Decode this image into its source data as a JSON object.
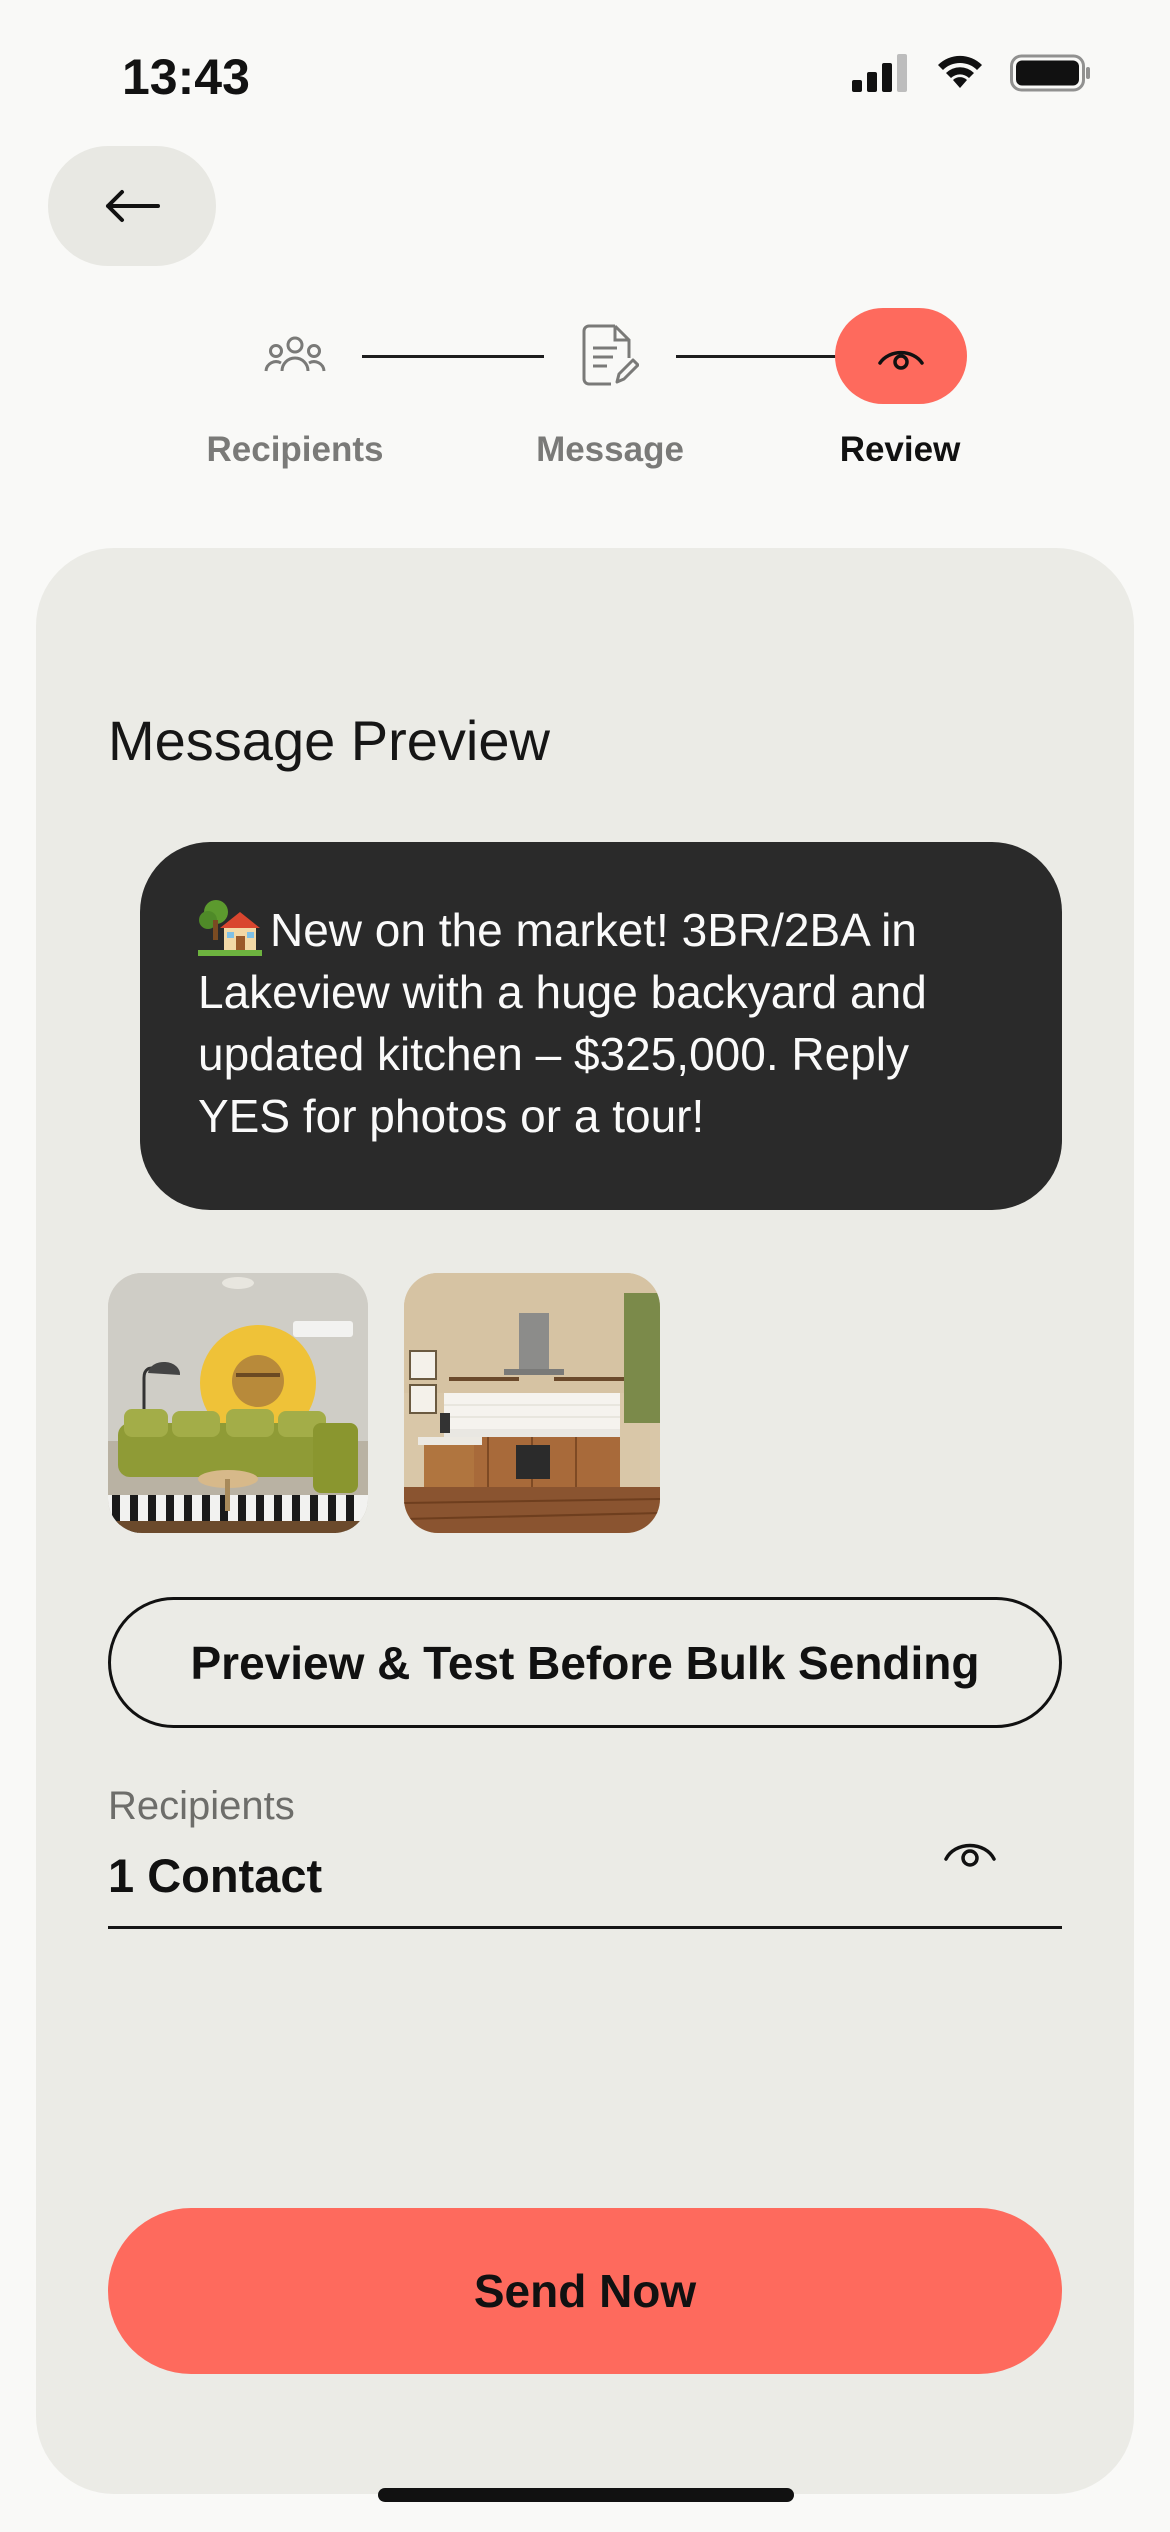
{
  "status_bar": {
    "time": "13:43"
  },
  "stepper": {
    "steps": [
      {
        "label": "Recipients",
        "icon": "people-icon",
        "active": false
      },
      {
        "label": "Message",
        "icon": "document-edit-icon",
        "active": false
      },
      {
        "label": "Review",
        "icon": "eye-icon",
        "active": true
      }
    ]
  },
  "card": {
    "title": "Message Preview",
    "message_text": "New on the market! 3BR/2BA in Lakeview with a huge backyard and updated kitchen – $325,000. Reply YES for photos or a tour!",
    "message_emoji": "house-with-garden-icon",
    "photos": [
      {
        "name": "living-room-photo"
      },
      {
        "name": "kitchen-photo"
      }
    ],
    "preview_button": "Preview & Test Before Bulk Sending",
    "recipients_label": "Recipients",
    "recipients_value": "1 Contact",
    "send_button": "Send Now"
  },
  "colors": {
    "accent": "#fe6a5d",
    "background": "#f9f9f7",
    "card": "#ebebe6",
    "bubble": "#2a2a2a"
  }
}
